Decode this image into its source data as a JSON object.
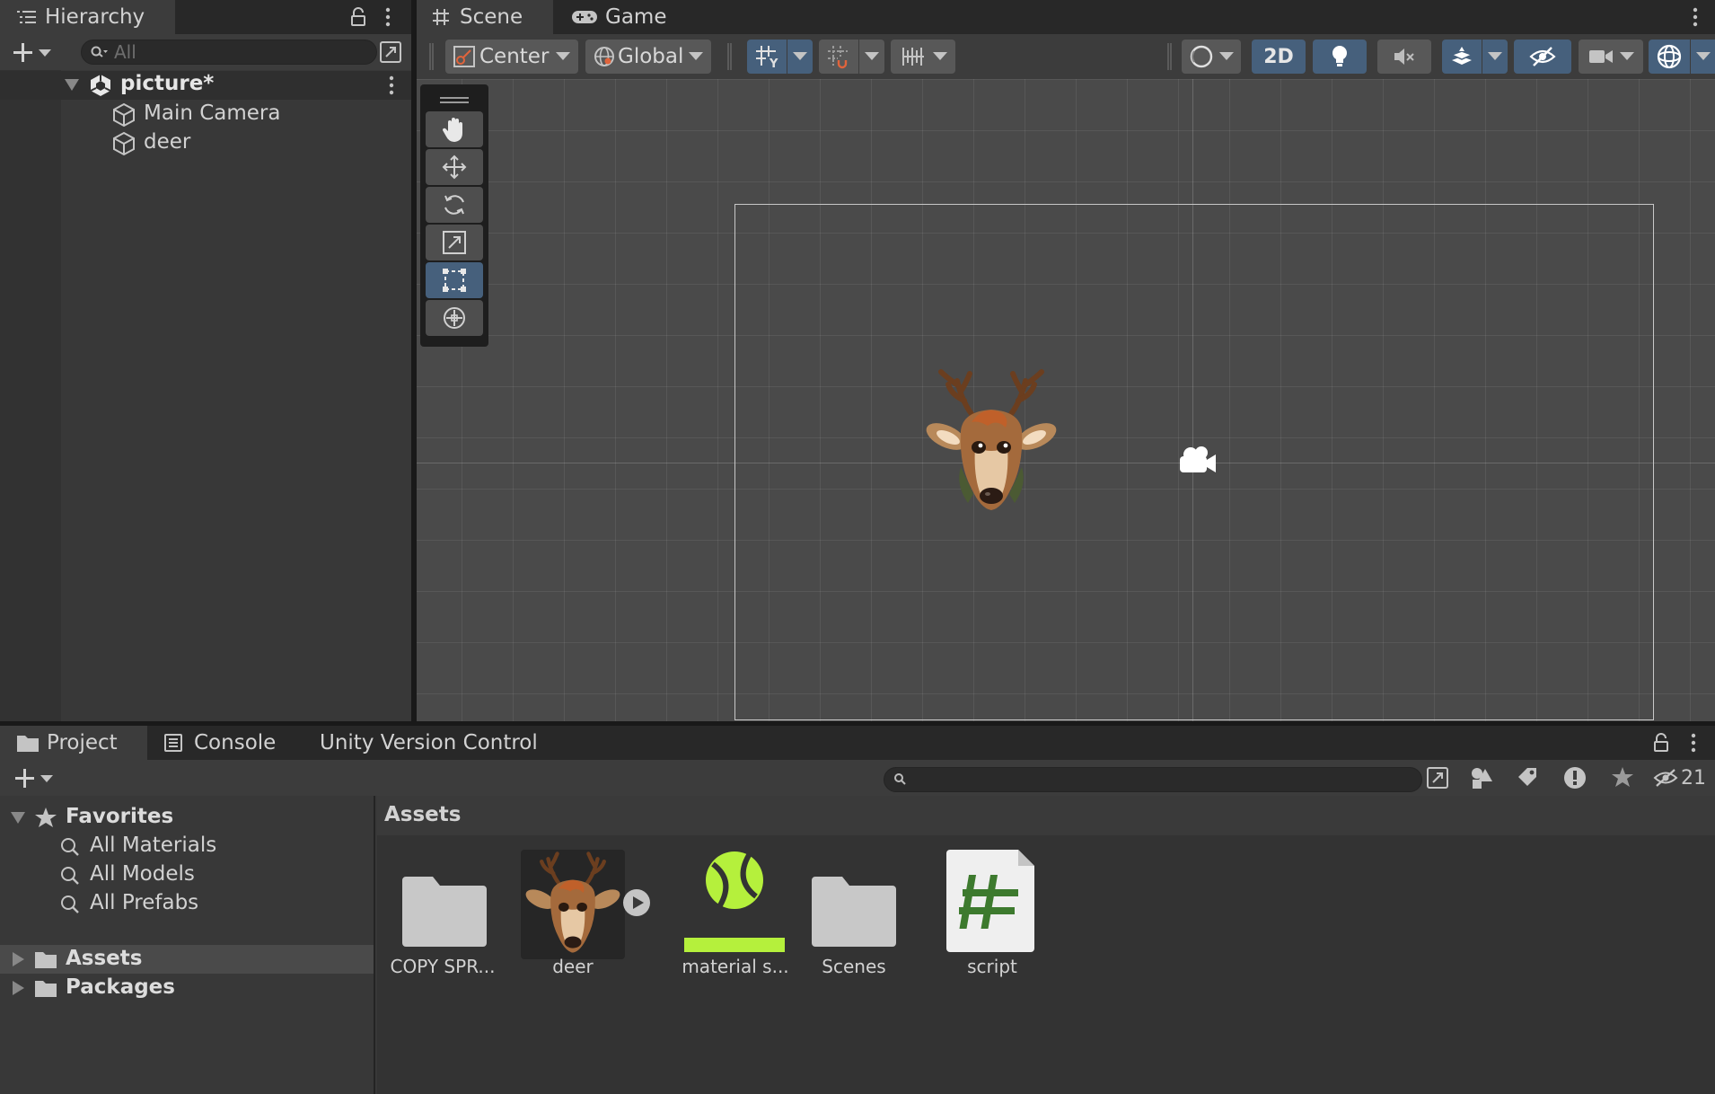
{
  "hierarchy": {
    "tab_label": "Hierarchy",
    "search_placeholder": "All",
    "scene_name": "picture*",
    "items": [
      {
        "label": "Main Camera"
      },
      {
        "label": "deer"
      }
    ]
  },
  "scene_view": {
    "tabs": [
      {
        "label": "Scene"
      },
      {
        "label": "Game"
      }
    ],
    "toolbar": {
      "pivot_mode": "Center",
      "pivot_rotation": "Global",
      "mode_2d_label": "2D"
    },
    "tools": [
      "hand-tool",
      "move-tool",
      "rotate-tool",
      "scale-tool",
      "rect-tool",
      "transform-tool"
    ],
    "active_tool": "rect-tool"
  },
  "bottom_panel": {
    "tabs": [
      {
        "label": "Project"
      },
      {
        "label": "Console"
      },
      {
        "label": "Unity Version Control"
      }
    ],
    "hidden_count": "21",
    "favorites": {
      "label": "Favorites",
      "items": [
        {
          "label": "All Materials"
        },
        {
          "label": "All Models"
        },
        {
          "label": "All Prefabs"
        }
      ]
    },
    "roots": [
      {
        "label": "Assets"
      },
      {
        "label": "Packages"
      }
    ],
    "breadcrumb": "Assets",
    "assets": [
      {
        "label": "COPY SPR...",
        "icon": "folder-icon"
      },
      {
        "label": "deer",
        "icon": "deer-sprite-thumbnail"
      },
      {
        "label": "material s...",
        "icon": "physics-material-icon"
      },
      {
        "label": "Scenes",
        "icon": "folder-icon"
      },
      {
        "label": "script",
        "icon": "csharp-script-icon"
      }
    ]
  },
  "colors": {
    "panel_bg": "#383838",
    "scene_bg": "#4a4a4a",
    "active_blue": "#46607c",
    "material_green": "#b5f03c",
    "script_green": "#3d7a2e"
  }
}
